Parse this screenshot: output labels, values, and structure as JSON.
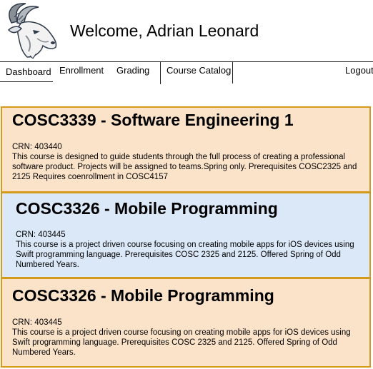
{
  "header": {
    "welcome_text": "Welcome, Adrian Leonard"
  },
  "nav": {
    "items": [
      {
        "label": "Dashboard"
      },
      {
        "label": "Enrollment"
      },
      {
        "label": "Grading"
      },
      {
        "label": "Course Catalog"
      },
      {
        "label": "Logout"
      }
    ]
  },
  "courses": [
    {
      "title": "COSC3339 - Software Engineering 1",
      "crn": "CRN: 403440",
      "description": "This course is designed to guide students through the full process of creating a professional software product. Projects will be assigned to teams.Spring only. Prerequisites COSC2325 and 2125 Requires coenrollment in COSC4157"
    },
    {
      "title": "COSC3326 - Mobile Programming",
      "crn": "CRN: 403445",
      "description": "This course is a project driven course focusing on creating mobile apps for iOS devices using Swift programming language. Prerequisites COSC 2325 and 2125. Offered Spring of Odd Numbered Years."
    },
    {
      "title": "COSC3326 - Mobile Programming",
      "crn": "CRN: 403445",
      "description": "This course is a project driven course focusing on creating mobile apps for iOS devices using Swift programming language. Prerequisites COSC 2325 and 2125. Offered Spring of Odd Numbered Years."
    }
  ],
  "colors": {
    "card_orange": "#fbe3c9",
    "card_blue": "#dbe8f8",
    "card_border": "#d49a1c"
  }
}
